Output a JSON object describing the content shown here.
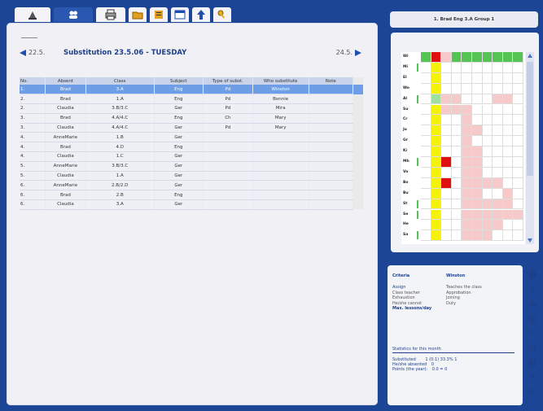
{
  "toolbar": {
    "tabs": [
      {
        "icon": "hand-icon",
        "active": false
      },
      {
        "icon": "people-icon",
        "active": true
      },
      {
        "icon": "printer-icon",
        "active": false
      },
      {
        "icon": "folder-icon",
        "active": false
      },
      {
        "icon": "list-icon",
        "active": false
      },
      {
        "icon": "window-icon",
        "active": false
      },
      {
        "icon": "arrow-icon",
        "active": false
      },
      {
        "icon": "key-icon",
        "active": false
      }
    ]
  },
  "nav": {
    "prev_label": "22.5.",
    "title": "Substitution 23.5.06 - TUESDAY",
    "next_label": "24.5."
  },
  "table": {
    "headers": [
      "No.",
      "Absent",
      "Class",
      "Subject",
      "Type of subst.",
      "Who substitute",
      "Note"
    ],
    "rows": [
      {
        "no": "1.",
        "absent": "Brad",
        "class": "3.A",
        "subject": "Eng",
        "type": "Pd",
        "who": "Winston",
        "note": "",
        "selected": true
      },
      {
        "no": "2.",
        "absent": "Brad",
        "class": "1.A",
        "subject": "Eng",
        "type": "Pd",
        "who": "Bonnie",
        "note": ""
      },
      {
        "no": "2.",
        "absent": "Claudia",
        "class": "3.B/3.C",
        "subject": "Ger",
        "type": "Pd",
        "who": "Mira",
        "note": ""
      },
      {
        "no": "3.",
        "absent": "Brad",
        "class": "4.A/4.C",
        "subject": "Eng",
        "type": "Ch",
        "who": "Mary",
        "note": ""
      },
      {
        "no": "3.",
        "absent": "Claudia",
        "class": "4.A/4.C",
        "subject": "Ger",
        "type": "Pd",
        "who": "Mary",
        "note": ""
      },
      {
        "no": "4.",
        "absent": "AnneMarie",
        "class": "1.B",
        "subject": "Ger",
        "type": "",
        "who": "",
        "note": ""
      },
      {
        "no": "4.",
        "absent": "Brad",
        "class": "4.D",
        "subject": "Eng",
        "type": "",
        "who": "",
        "note": ""
      },
      {
        "no": "4.",
        "absent": "Claudia",
        "class": "1.C",
        "subject": "Ger",
        "type": "",
        "who": "",
        "note": ""
      },
      {
        "no": "5.",
        "absent": "AnneMarie",
        "class": "3.B/3.C",
        "subject": "Ger",
        "type": "",
        "who": "",
        "note": ""
      },
      {
        "no": "5.",
        "absent": "Claudia",
        "class": "1.A",
        "subject": "Ger",
        "type": "",
        "who": "",
        "note": ""
      },
      {
        "no": "6.",
        "absent": "AnneMarie",
        "class": "2.B/2.D",
        "subject": "Ger",
        "type": "",
        "who": "",
        "note": ""
      },
      {
        "no": "6.",
        "absent": "Brad",
        "class": "2.B",
        "subject": "Eng",
        "type": "",
        "who": "",
        "note": ""
      },
      {
        "no": "6.",
        "absent": "Claudia",
        "class": "3.A",
        "subject": "Ger",
        "type": "",
        "who": "",
        "note": ""
      }
    ]
  },
  "right_header": "1. Brad Eng 3.A Group 1",
  "grid": {
    "rows": [
      "Wi",
      "Mi",
      "El",
      "Wo",
      "Al",
      "Su",
      "Cr",
      "Ju",
      "Gr",
      "Ki",
      "Mh",
      "Vo",
      "Bo",
      "Bu",
      "St",
      "Se",
      "He",
      "Sa"
    ],
    "cols": 10,
    "colors": {
      "yellow": "#f5f20a",
      "green": "#55c455",
      "lightgreen": "#9fe09f",
      "pink": "#f6c9cb",
      "red": "#e01010",
      "white": "#ffffff"
    }
  },
  "criteria": {
    "title_left": "Criteria",
    "title_right": "Winston",
    "left_items": [
      "Assign",
      "Class teacher",
      "Exhaustion",
      "He/she cannot",
      "Max. lessons/day"
    ],
    "right_items": [
      "Teaches the class",
      "Approbation",
      "Joining",
      "Duty"
    ],
    "stats_title": "Statistics for this month",
    "stats": [
      {
        "label": "Substituted",
        "value": "1 (0:1)   33.3%  1"
      },
      {
        "label": "He/she absented",
        "value": "0"
      },
      {
        "label": "Points (the year):",
        "value": "0.0 = 0"
      }
    ]
  },
  "side_tools": [
    "people-icon",
    "group-icon",
    "bar-icon",
    "save-icon",
    "pen-icon",
    "window-icon",
    "calendar-icon",
    "help-icon",
    "settings-icon"
  ]
}
